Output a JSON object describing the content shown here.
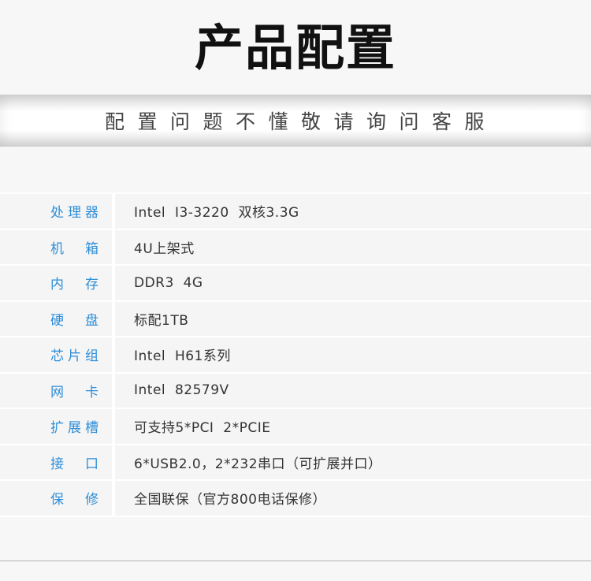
{
  "header": {
    "title": "产品配置"
  },
  "banner": {
    "text": "配置问题不懂敬请询问客服"
  },
  "specs": [
    {
      "label": "处理器",
      "value": "Intel  I3-3220  双核3.3G"
    },
    {
      "label": "机箱",
      "value": "4U上架式"
    },
    {
      "label": "内存",
      "value": "DDR3  4G"
    },
    {
      "label": "硬盘",
      "value": "标配1TB"
    },
    {
      "label": "芯片组",
      "value": "Intel  H61系列"
    },
    {
      "label": "网卡",
      "value": "Intel  82579V"
    },
    {
      "label": "扩展槽",
      "value": "可支持5*PCI  2*PCIE"
    },
    {
      "label": "接口",
      "value": "6*USB2.0，2*232串口（可扩展并口）"
    },
    {
      "label": "保修",
      "value": "全国联保（官方800电话保修）"
    }
  ]
}
